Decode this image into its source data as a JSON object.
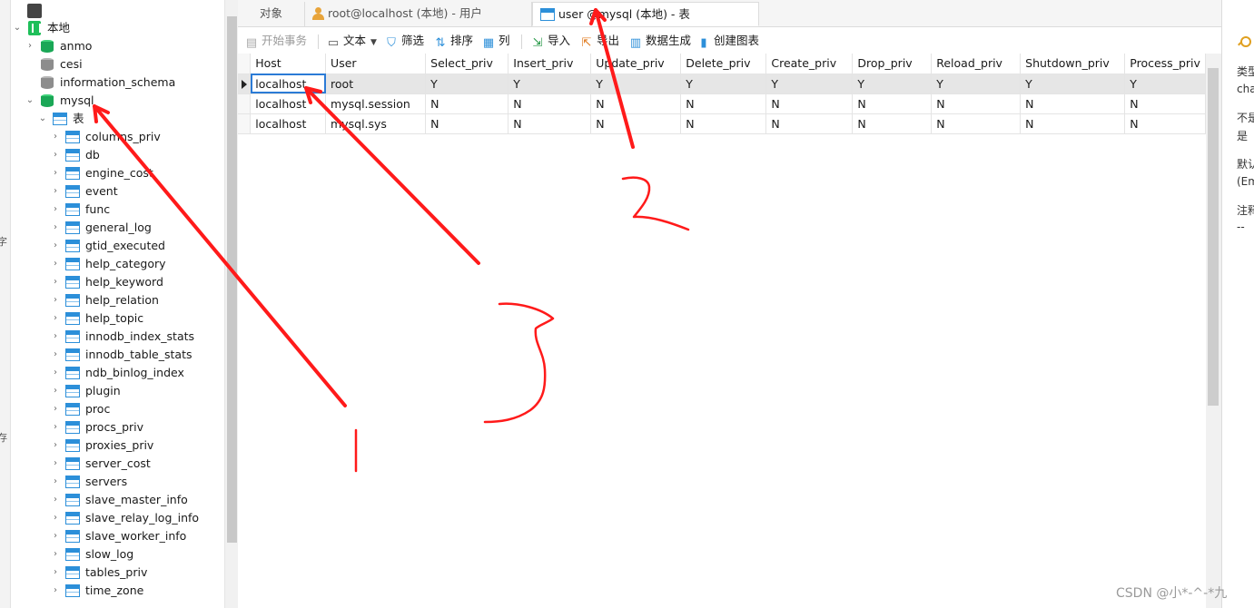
{
  "colors": {
    "annotation": "#ff1a1a",
    "selection_border": "#2b7bd6",
    "table_icon": "#2c8fd9",
    "db_active": "#1aa756",
    "db_inactive": "#8d8d8d"
  },
  "left_strip": {
    "glyphs": [
      "字",
      "存"
    ]
  },
  "navigator": {
    "connection": {
      "label": "本地",
      "icon": "connection-icon"
    },
    "databases": [
      {
        "label": "anmo",
        "icon": "database-icon-green",
        "expanded": false
      },
      {
        "label": "cesi",
        "icon": "database-icon-grey",
        "expanded": false
      },
      {
        "label": "information_schema",
        "icon": "database-icon-grey",
        "expanded": false
      },
      {
        "label": "mysql",
        "icon": "database-icon-green",
        "expanded": true
      }
    ],
    "tables_node": {
      "label": "表"
    },
    "tables": [
      "columns_priv",
      "db",
      "engine_cost",
      "event",
      "func",
      "general_log",
      "gtid_executed",
      "help_category",
      "help_keyword",
      "help_relation",
      "help_topic",
      "innodb_index_stats",
      "innodb_table_stats",
      "ndb_binlog_index",
      "plugin",
      "proc",
      "procs_priv",
      "proxies_priv",
      "server_cost",
      "servers",
      "slave_master_info",
      "slave_relay_log_info",
      "slave_worker_info",
      "slow_log",
      "tables_priv",
      "time_zone"
    ]
  },
  "tabs": [
    {
      "label": "对象",
      "icon": ""
    },
    {
      "label": "root@localhost (本地) - 用户",
      "icon": "user-icon"
    },
    {
      "label": "user @mysql (本地) - 表",
      "icon": "table-icon",
      "active": true
    }
  ],
  "toolbar": {
    "begin_transaction": "开始事务",
    "text": "文本",
    "filter": "筛选",
    "sort": "排序",
    "columns": "列",
    "import": "导入",
    "export": "导出",
    "data_generation": "数据生成",
    "create_chart": "创建图表"
  },
  "grid": {
    "columns": [
      "Host",
      "User",
      "Select_priv",
      "Insert_priv",
      "Update_priv",
      "Delete_priv",
      "Create_priv",
      "Drop_priv",
      "Reload_priv",
      "Shutdown_priv",
      "Process_priv"
    ],
    "rows": [
      [
        "localhost",
        "root",
        "Y",
        "Y",
        "Y",
        "Y",
        "Y",
        "Y",
        "Y",
        "Y",
        "Y"
      ],
      [
        "localhost",
        "mysql.session",
        "N",
        "N",
        "N",
        "N",
        "N",
        "N",
        "N",
        "N",
        "N"
      ],
      [
        "localhost",
        "mysql.sys",
        "N",
        "N",
        "N",
        "N",
        "N",
        "N",
        "N",
        "N",
        "N"
      ]
    ]
  },
  "info_panel": {
    "lines": [
      "类型",
      "cha",
      "不是",
      "是",
      "默认",
      "(Em",
      "注释",
      "--"
    ]
  },
  "watermark": "CSDN @小*-^-*九",
  "annotations": [
    "1",
    "2",
    "3"
  ]
}
